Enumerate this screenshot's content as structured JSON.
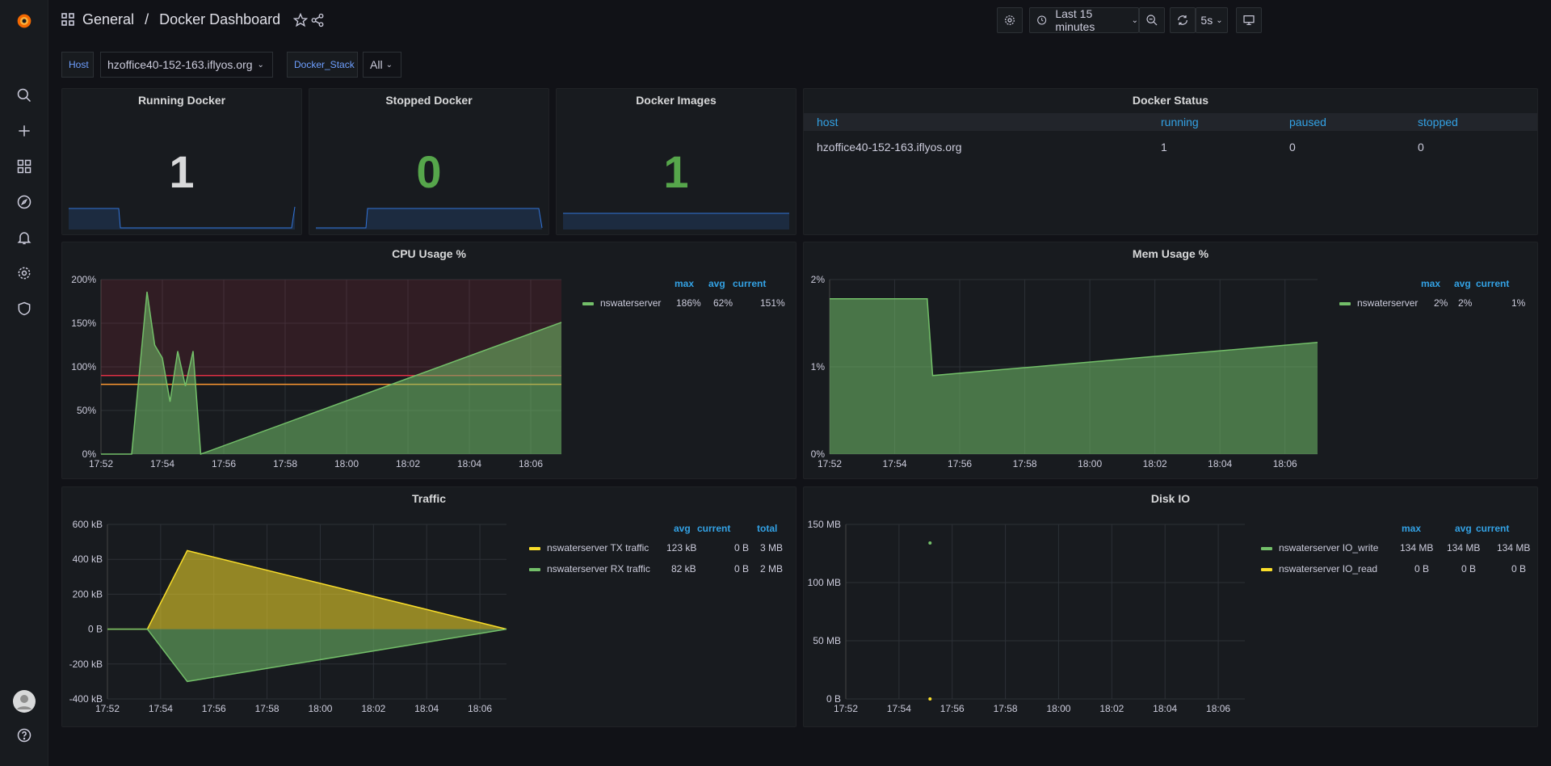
{
  "breadcrumb": {
    "folder": "General",
    "separator": "/",
    "dashboard": "Docker Dashboard"
  },
  "toolbar": {
    "time_range": "Last 15 minutes",
    "refresh": "5s"
  },
  "variables": [
    {
      "label": "Host",
      "value": "hzoffice40-152-163.iflyos.org"
    },
    {
      "label": "Docker_Stack",
      "value": "All"
    }
  ],
  "panels": {
    "running": {
      "title": "Running Docker",
      "value": "1"
    },
    "stopped": {
      "title": "Stopped Docker",
      "value": "0"
    },
    "images": {
      "title": "Docker Images",
      "value": "1"
    },
    "status": {
      "title": "Docker Status",
      "columns": [
        "host",
        "running",
        "paused",
        "stopped"
      ],
      "rows": [
        [
          "hzoffice40-152-163.iflyos.org",
          "1",
          "0",
          "0"
        ]
      ]
    },
    "cpu": {
      "title": "CPU Usage %",
      "legend_headers": [
        "max",
        "avg",
        "current"
      ],
      "legend": [
        {
          "name": "nswaterserver",
          "max": "186%",
          "avg": "62%",
          "current": "151%"
        }
      ]
    },
    "mem": {
      "title": "Mem Usage %",
      "legend_headers": [
        "max",
        "avg",
        "current"
      ],
      "legend": [
        {
          "name": "nswaterserver",
          "max": "2%",
          "avg": "2%",
          "current": "1%"
        }
      ]
    },
    "traffic": {
      "title": "Traffic",
      "legend_headers": [
        "avg",
        "current",
        "total"
      ],
      "legend": [
        {
          "name": "nswaterserver TX traffic",
          "avg": "123 kB",
          "current": "0 B",
          "total": "3 MB"
        },
        {
          "name": "nswaterserver RX traffic",
          "avg": "82 kB",
          "current": "0 B",
          "total": "2 MB"
        }
      ]
    },
    "disk": {
      "title": "Disk IO",
      "legend_headers": [
        "max",
        "avg",
        "current"
      ],
      "legend": [
        {
          "name": "nswaterserver IO_write",
          "max": "134 MB",
          "avg": "134 MB",
          "current": "134 MB"
        },
        {
          "name": "nswaterserver IO_read",
          "max": "0 B",
          "avg": "0 B",
          "current": "0 B"
        }
      ]
    }
  },
  "colors": {
    "green": "#73bf69",
    "yellow": "#fade2a",
    "blue": "#3274d9",
    "orange": "#ff9830",
    "red": "#e02f44",
    "accent": "#33a2e5"
  },
  "chart_data": [
    {
      "type": "area",
      "title": "CPU Usage %",
      "x": [
        "17:52",
        "17:53",
        "17:53:30",
        "17:53:45",
        "17:54",
        "17:54:15",
        "17:54:30",
        "17:54:45",
        "17:55",
        "17:55:15",
        "18:07"
      ],
      "x_ticks": [
        "17:52",
        "17:54",
        "17:56",
        "17:58",
        "18:00",
        "18:02",
        "18:04",
        "18:06"
      ],
      "y_ticks": [
        "0%",
        "50%",
        "100%",
        "150%",
        "200%"
      ],
      "ylim": [
        0,
        200
      ],
      "thresholds": [
        80,
        90
      ],
      "series": [
        {
          "name": "nswaterserver",
          "values": [
            0,
            0,
            186,
            125,
            110,
            60,
            118,
            78,
            118,
            0,
            151
          ]
        }
      ]
    },
    {
      "type": "area",
      "title": "Mem Usage %",
      "x": [
        "17:52",
        "17:55",
        "17:55:10",
        "18:07"
      ],
      "x_ticks": [
        "17:52",
        "17:54",
        "17:56",
        "17:58",
        "18:00",
        "18:02",
        "18:04",
        "18:06"
      ],
      "y_ticks": [
        "0%",
        "1%",
        "2%"
      ],
      "ylim": [
        0,
        2
      ],
      "series": [
        {
          "name": "nswaterserver",
          "values": [
            1.78,
            1.78,
            0.9,
            1.28
          ]
        }
      ]
    },
    {
      "type": "area",
      "title": "Traffic",
      "x": [
        "17:52",
        "17:53:30",
        "17:55",
        "18:07"
      ],
      "x_ticks": [
        "17:52",
        "17:54",
        "17:56",
        "17:58",
        "18:00",
        "18:02",
        "18:04",
        "18:06"
      ],
      "y_ticks": [
        "-400 kB",
        "-200 kB",
        "0 B",
        "200 kB",
        "400 kB",
        "600 kB"
      ],
      "ylim": [
        -400,
        600
      ],
      "series": [
        {
          "name": "nswaterserver TX traffic",
          "values": [
            0,
            0,
            450,
            0
          ]
        },
        {
          "name": "nswaterserver RX traffic",
          "values": [
            0,
            0,
            -300,
            0
          ]
        }
      ]
    },
    {
      "type": "scatter",
      "title": "Disk IO",
      "x_ticks": [
        "17:52",
        "17:54",
        "17:56",
        "17:58",
        "18:00",
        "18:02",
        "18:04",
        "18:06"
      ],
      "y_ticks": [
        "0 B",
        "50 MB",
        "100 MB",
        "150 MB"
      ],
      "ylim": [
        0,
        150
      ],
      "series": [
        {
          "name": "nswaterserver IO_write",
          "x": [
            "17:55:10"
          ],
          "values": [
            134
          ]
        },
        {
          "name": "nswaterserver IO_read",
          "x": [
            "17:55:10"
          ],
          "values": [
            0
          ]
        }
      ]
    }
  ]
}
